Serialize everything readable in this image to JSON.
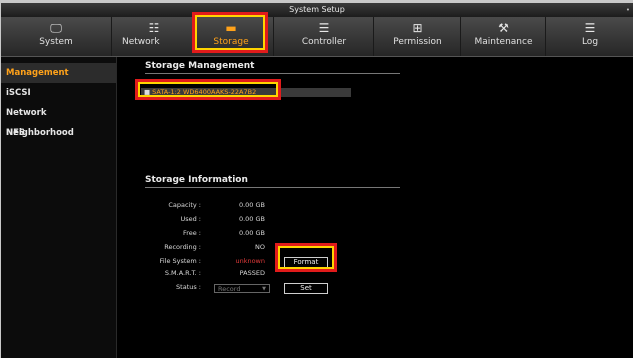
{
  "title": "System Setup",
  "nav": {
    "tabs": [
      {
        "label": "System",
        "icon": "monitor-icon"
      },
      {
        "label": "Network",
        "icon": "network-icon"
      },
      {
        "label": "Storage",
        "icon": "storage-icon",
        "active": true
      },
      {
        "label": "Controller",
        "icon": "controller-icon"
      },
      {
        "label": "Permission",
        "icon": "permission-icon"
      },
      {
        "label": "Maintenance",
        "icon": "tools-icon"
      },
      {
        "label": "Log",
        "icon": "log-icon"
      }
    ]
  },
  "sidebar": {
    "items": [
      {
        "label": "Management",
        "active": true
      },
      {
        "label": "iSCSI"
      },
      {
        "label": "Network Neighborhood"
      },
      {
        "label": "NFS"
      }
    ]
  },
  "storage_management": {
    "title": "Storage Management",
    "disk": "SATA-1:2 WD6400AAKS-22A7B2"
  },
  "storage_information": {
    "title": "Storage Information",
    "capacity_label": "Capacity :",
    "capacity": "0.00 GB",
    "used_label": "Used :",
    "used": "0.00 GB",
    "free_label": "Free :",
    "free": "0.00 GB",
    "recording_label": "Recording :",
    "recording": "NO",
    "filesystem_label": "File System :",
    "filesystem": "unknown",
    "smart_label": "S.M.A.R.T. :",
    "smart": "PASSED",
    "status_label": "Status :",
    "status_select": "Record",
    "format_button": "Format",
    "set_button": "Set"
  },
  "colors": {
    "accent": "#ffa21a",
    "error": "#e23b3b",
    "highlight_outer": "#e11b1b",
    "highlight_inner": "#ffd400"
  }
}
